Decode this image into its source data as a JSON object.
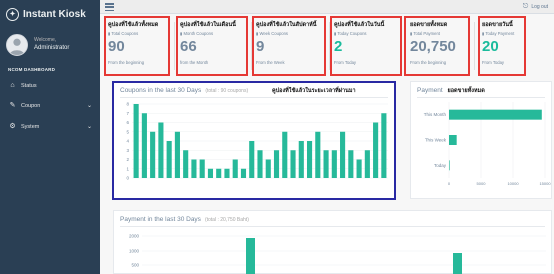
{
  "app": {
    "title": "Instant Kiosk"
  },
  "profile": {
    "welcome": "Welcome,",
    "name": "Administrator"
  },
  "sidebar": {
    "section_title": "NCOM DASHBOARD",
    "items": [
      {
        "label": "Status",
        "icon": "home-icon"
      },
      {
        "label": "Coupon",
        "icon": "edit-icon",
        "has_chevron": true
      },
      {
        "label": "System",
        "icon": "gear-icon",
        "has_chevron": true
      }
    ]
  },
  "topbar": {
    "logout_label": "Log out"
  },
  "tiles": [
    {
      "annotation": "คูปองที่ใช้แล้วทั้งหมด",
      "label": "Total Coupons",
      "value": "90",
      "footer": "From the beginning",
      "green": false
    },
    {
      "annotation": "คูปองที่ใช้แล้วในเดือนนี้",
      "label": "Month Coupons",
      "value": "66",
      "footer": "from the Month",
      "green": false
    },
    {
      "annotation": "คูปองที่ใช้แล้วในสัปดาห์นี้",
      "label": "Week Coupons",
      "value": "9",
      "footer": "From the Week",
      "green": false
    },
    {
      "annotation": "คูปองที่ใช้แล้วในวันนี้",
      "label": "Today Coupons",
      "value": "2",
      "footer": "From Today",
      "green": true
    },
    {
      "annotation": "ยอดขายทั้งหมด",
      "label": "Total Payment",
      "value": "20,750",
      "footer": "From the beginning",
      "green": false
    },
    {
      "annotation": "ยอดขายวันนี้",
      "label": "Today Payment",
      "value": "20",
      "footer": "From Today",
      "green": true
    }
  ],
  "coupon_panel": {
    "title": "Coupons in the last 30 Days",
    "subtitle": "(total : 90 coupons)",
    "annotation": "คูปองที่ใช้แล้วในระยะเวลาที่ผ่านมา"
  },
  "payment_panel": {
    "title": "Payment",
    "annotation": "ยอดขายทั้งหมด"
  },
  "payment30_panel": {
    "title": "Payment in the last 30 Days",
    "subtitle": "(total : 20,750 Baht)"
  },
  "colors": {
    "accent": "#1abb9c",
    "sidebar": "#2a3f54",
    "highlight": "#e53935",
    "highlight_blue": "#2929a3"
  },
  "chart_data": [
    {
      "type": "bar",
      "title": "Coupons in the last 30 Days",
      "categories": [
        "",
        "",
        "",
        "",
        "",
        "",
        "",
        "",
        "",
        "",
        "",
        "",
        "",
        "",
        "",
        "",
        "",
        "",
        "",
        "",
        "",
        "",
        "",
        "",
        "",
        "",
        "",
        "",
        "",
        ""
      ],
      "values": [
        8,
        7,
        5,
        6,
        4,
        5,
        3,
        2,
        2,
        1,
        1,
        1,
        2,
        1,
        4,
        3,
        2,
        3,
        5,
        3,
        4,
        4,
        5,
        3,
        3,
        5,
        3,
        2,
        3,
        6,
        7
      ],
      "ylim": [
        0,
        8
      ],
      "yticks": [
        "0",
        "1",
        "2",
        "3",
        "4",
        "5",
        "6",
        "7",
        "8"
      ],
      "color": "#26b99a"
    },
    {
      "type": "bar",
      "orientation": "horizontal",
      "title": "Payment",
      "categories": [
        "This Month",
        "This Week",
        "Today"
      ],
      "values": [
        14500,
        1200,
        100
      ],
      "ylim": [
        0,
        15000
      ],
      "xticks": [
        "0",
        "5000",
        "10000",
        "15000"
      ],
      "color": "#26b99a"
    },
    {
      "type": "bar",
      "title": "Payment in the last 30 Days",
      "categories": [],
      "yticks": [
        "2000",
        "1000",
        "500"
      ],
      "color": "#26b99a"
    }
  ]
}
